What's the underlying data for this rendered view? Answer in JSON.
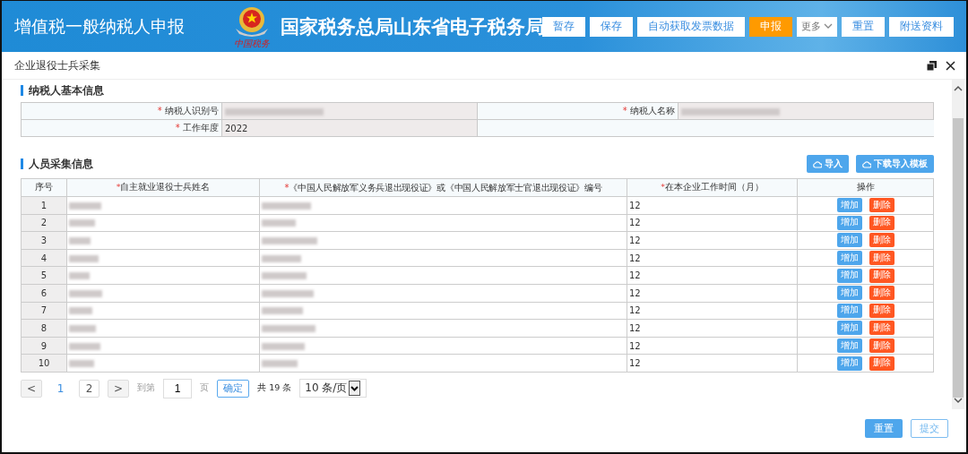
{
  "header": {
    "title": "增值税一般纳税人申报",
    "logo_caption": "中国税务",
    "site_name": "国家税务总局山东省电子税务局",
    "buttons": [
      {
        "label": "暂存",
        "kind": "normal"
      },
      {
        "label": "保存",
        "kind": "normal"
      },
      {
        "label": "自动获取发票数据",
        "kind": "normal"
      },
      {
        "label": "申报",
        "kind": "accent"
      },
      {
        "label": "更多",
        "kind": "dropdown"
      },
      {
        "label": "重置",
        "kind": "normal"
      },
      {
        "label": "附送资料",
        "kind": "normal"
      }
    ]
  },
  "dialog": {
    "title": "企业退役士兵采集"
  },
  "basic_info": {
    "heading": "纳税人基本信息",
    "rows": [
      [
        {
          "marker": "*",
          "label": "纳税人识别号",
          "redacted": true
        },
        {
          "marker": "*",
          "label": "纳税人名称",
          "redacted": true
        }
      ],
      [
        {
          "marker": "*",
          "label": "工作年度",
          "value": "2022",
          "redacted": false
        }
      ]
    ]
  },
  "personnel": {
    "heading": "人员采集信息",
    "tools": [
      "导入",
      "下载导入模板"
    ],
    "columns": [
      {
        "label": "序号"
      },
      {
        "marker": "*",
        "label": "自主就业退役士兵姓名"
      },
      {
        "marker": "*",
        "label": "《中国人民解放军义务兵退出现役证》或《中国人民解放军士官退出现役证》编号"
      },
      {
        "marker": "*",
        "label": "在本企业工作时间（月）"
      },
      {
        "label": "操作"
      }
    ],
    "rows": [
      {
        "no": "1",
        "months": "12",
        "actions": [
          "增加",
          "删除"
        ]
      },
      {
        "no": "2",
        "months": "12",
        "actions": [
          "增加",
          "删除"
        ]
      },
      {
        "no": "3",
        "months": "12",
        "actions": [
          "增加",
          "删除"
        ]
      },
      {
        "no": "4",
        "months": "12",
        "actions": [
          "增加",
          "删除"
        ]
      },
      {
        "no": "5",
        "months": "12",
        "actions": [
          "增加",
          "删除"
        ]
      },
      {
        "no": "6",
        "months": "12",
        "actions": [
          "增加",
          "删除"
        ]
      },
      {
        "no": "7",
        "months": "12",
        "actions": [
          "增加",
          "删除"
        ]
      },
      {
        "no": "8",
        "months": "12",
        "actions": [
          "增加",
          "删除"
        ]
      },
      {
        "no": "9",
        "months": "12",
        "actions": [
          "增加",
          "删除"
        ]
      },
      {
        "no": "10",
        "months": "12",
        "actions": [
          "增加",
          "删除"
        ]
      }
    ]
  },
  "pagination": {
    "prev": "<",
    "pages": [
      {
        "label": "1",
        "selected": true
      },
      {
        "label": "2",
        "selected": false
      }
    ],
    "next": ">",
    "goto_label": "到第",
    "goto_value": "1",
    "page_label": "页",
    "confirm": "确定",
    "total": "共 19 条",
    "page_size": "10 条/页"
  },
  "footer": {
    "buttons": [
      {
        "label": "重置",
        "kind": "primary"
      },
      {
        "label": "提交",
        "kind": "outline"
      }
    ]
  }
}
